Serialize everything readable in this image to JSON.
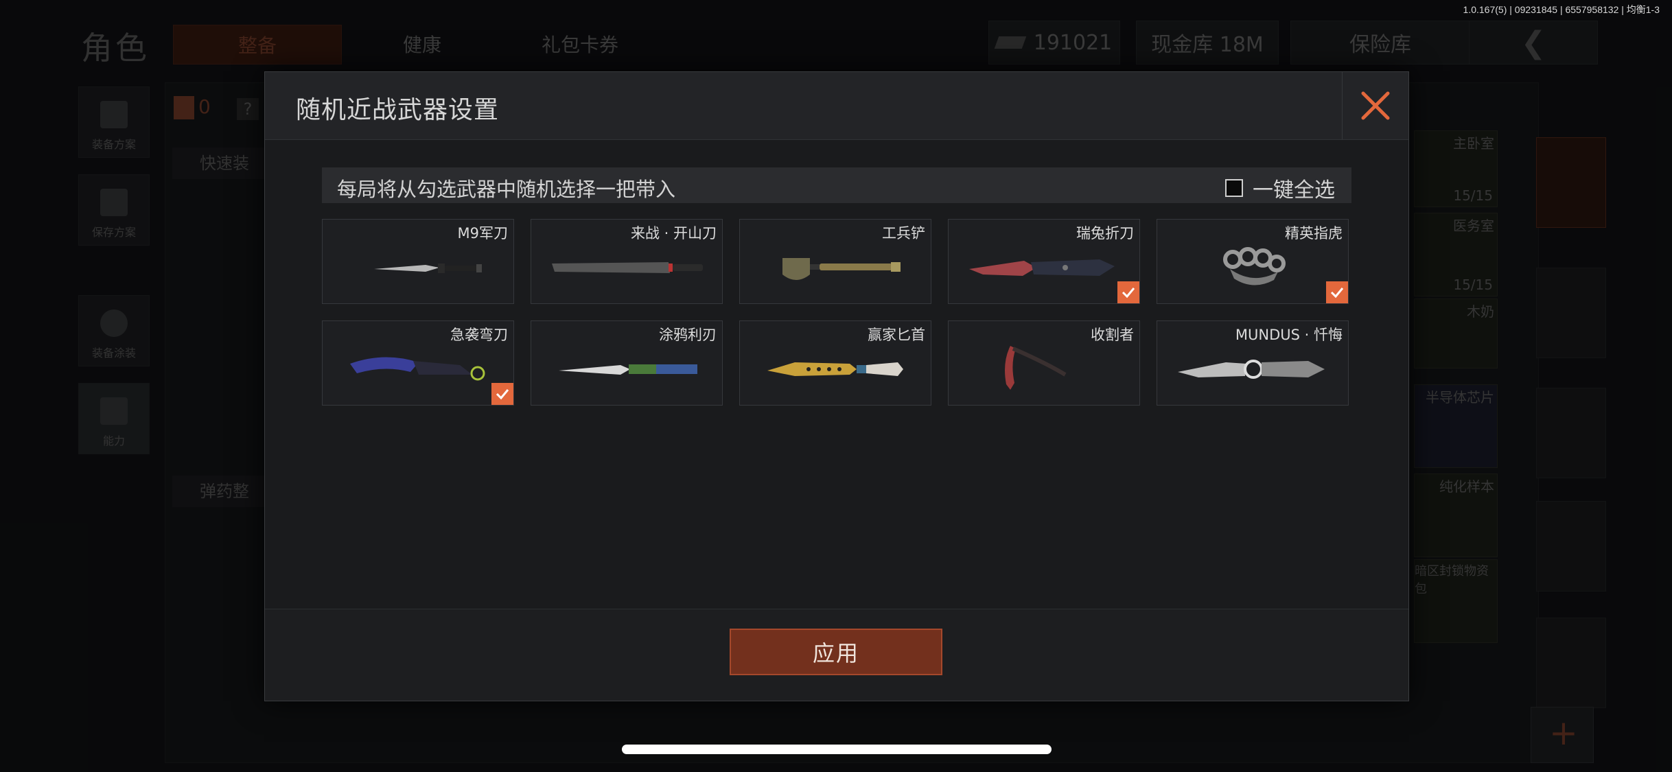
{
  "status": {
    "version": "1.0.167(5) | 09231845 | 6557958132 | 均衡1-3"
  },
  "background": {
    "page_title": "角色",
    "tabs": [
      {
        "label": "整备",
        "active": true
      },
      {
        "label": "健康",
        "active": false
      },
      {
        "label": "礼包卡券",
        "active": false
      }
    ],
    "currency": "191021",
    "cash_vault": "现金库 18M",
    "safe": "保险库",
    "side_buttons": [
      {
        "label": "装备方案",
        "icon": "vest-icon"
      },
      {
        "label": "保存方案",
        "icon": "download-icon"
      },
      {
        "label": "装备涂装",
        "icon": "helmet-icon"
      },
      {
        "label": "能力",
        "icon": "lightning-icon"
      }
    ],
    "panel_labels": {
      "quick_equip": "快速装",
      "ammo": "弹药整",
      "count": "0",
      "help": "?"
    },
    "items": [
      {
        "name": "主卧室",
        "count": "15/15"
      },
      {
        "name": "医务室",
        "count": "15/15"
      },
      {
        "name": "木奶",
        "count": ""
      },
      {
        "name": "半导体芯片",
        "count": ""
      },
      {
        "name": "纯化样本",
        "count": ""
      },
      {
        "name": "暗区封锁物资包",
        "count": ""
      }
    ]
  },
  "modal": {
    "title": "随机近战武器设置",
    "description": "每局将从勾选武器中随机选择一把带入",
    "select_all_label": "一键全选",
    "select_all_checked": false,
    "weapons": [
      {
        "name": "M9军刀",
        "checked": false,
        "icon": "bayonet-knife-icon"
      },
      {
        "name": "来战 · 开山刀",
        "checked": false,
        "icon": "machete-icon"
      },
      {
        "name": "工兵铲",
        "checked": false,
        "icon": "shovel-icon"
      },
      {
        "name": "瑞兔折刀",
        "checked": true,
        "icon": "folding-knife-icon"
      },
      {
        "name": "精英指虎",
        "checked": true,
        "icon": "brass-knuckles-icon"
      },
      {
        "name": "急袭弯刀",
        "checked": true,
        "icon": "karambit-icon"
      },
      {
        "name": "涂鸦利刃",
        "checked": false,
        "icon": "graffiti-blade-icon"
      },
      {
        "name": "赢家匕首",
        "checked": false,
        "icon": "dagger-icon"
      },
      {
        "name": "收割者",
        "checked": false,
        "icon": "scythe-icon"
      },
      {
        "name": "MUNDUS · 忏悔",
        "checked": false,
        "icon": "ornate-knife-icon"
      }
    ],
    "apply_label": "应用"
  },
  "colors": {
    "accent": "#e3683c",
    "apply_bg": "#73301d",
    "modal_bg": "#1a1b1d"
  }
}
